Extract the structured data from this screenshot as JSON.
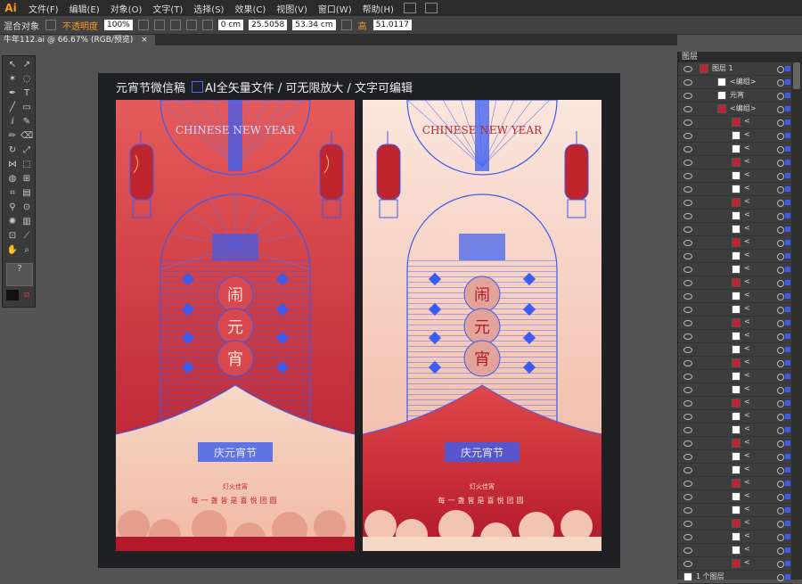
{
  "menubar": {
    "logo": "Ai",
    "items": [
      "文件(F)",
      "编辑(E)",
      "对象(O)",
      "文字(T)",
      "选择(S)",
      "效果(C)",
      "视图(V)",
      "窗口(W)",
      "帮助(H)"
    ]
  },
  "control_bar": {
    "mixed_objects_label": "混合对象",
    "opacity_label": "不透明度",
    "opacity_value": "100%",
    "x_value": "0 cm",
    "w_value": "25.5058",
    "h_value": "53.34 cm",
    "angle_label": "高",
    "y_value": "51.0117"
  },
  "document_tab": {
    "title": "牛年112.ai @ 66.67% (RGB/预览)",
    "close": "×"
  },
  "artwork": {
    "title": "元宵节微信稿",
    "subtitle": "AI全矢量文件 / 可无限放大 / 文字可编辑",
    "chinese_new_year": "CHINESE NEW YEAR",
    "chars": [
      "闹",
      "元",
      "宵"
    ],
    "badge_text": "庆元宵节",
    "small_text": "灯火佳宵",
    "slogan": "每一盏皆是喜悦团圆"
  },
  "layers_panel": {
    "title": "图层",
    "layer1": "图层 1",
    "group_label": "<编组>",
    "yuanxiao_label": "元宵",
    "bottom_label": "1 个图层",
    "generic_label": "<"
  },
  "colors": {
    "accent": "#3b5cf0",
    "red_dark": "#b2192a",
    "red_light": "#e55b5b",
    "peach": "#f7d8c6",
    "pink": "#efb3a0"
  }
}
